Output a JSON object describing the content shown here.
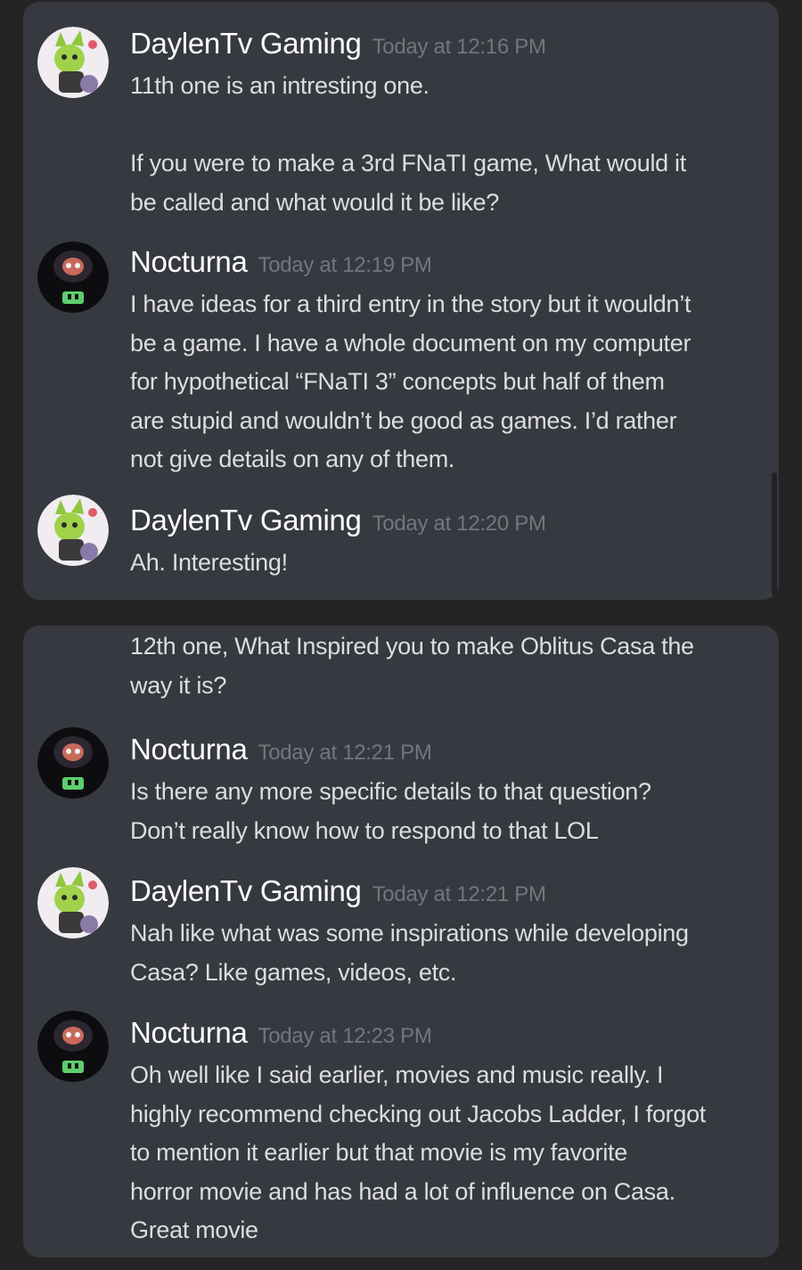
{
  "colors": {
    "page_background": "#262324",
    "panel_background": "#36393f",
    "author_name": "#ffffff",
    "timestamp": "#72767d",
    "message_text": "#dcddde",
    "daylen_avatar_bg": "#f1ecef",
    "nocturna_avatar_bg": "#0d0d0f"
  },
  "panel_1": {
    "messages": [
      {
        "author": "DaylenTv Gaming",
        "timestamp": "Today at 12:16 PM",
        "avatar": "daylen-avatar",
        "lines": [
          "11th one is an intresting one.",
          "",
          "If you were to make a 3rd FNaTI game, What would it",
          "be called and what would it be like?"
        ]
      },
      {
        "author": "Nocturna",
        "timestamp": "Today at 12:19 PM",
        "avatar": "nocturna-avatar",
        "lines": [
          "I have ideas for a third entry in the story but it wouldn’t",
          "be a game. I have a whole document on my computer",
          "for hypothetical “FNaTI 3” concepts but half of them",
          "are stupid and wouldn’t be good as games. I’d rather",
          "not give details on any of them."
        ]
      },
      {
        "author": "DaylenTv Gaming",
        "timestamp": "Today at 12:20 PM",
        "avatar": "daylen-avatar",
        "lines": [
          "Ah. Interesting!"
        ]
      }
    ]
  },
  "panel_2": {
    "continuation": {
      "lines": [
        "12th one, What Inspired you to make Oblitus Casa the",
        "way it is?"
      ]
    },
    "messages": [
      {
        "author": "Nocturna",
        "timestamp": "Today at 12:21 PM",
        "avatar": "nocturna-avatar",
        "lines": [
          "Is there any more specific details to that question?",
          "Don’t really know how to respond to that LOL"
        ]
      },
      {
        "author": "DaylenTv Gaming",
        "timestamp": "Today at 12:21 PM",
        "avatar": "daylen-avatar",
        "lines": [
          "Nah like what was some inspirations while developing",
          "Casa? Like games, videos, etc."
        ]
      },
      {
        "author": "Nocturna",
        "timestamp": "Today at 12:23 PM",
        "avatar": "nocturna-avatar",
        "lines": [
          "Oh well like I said earlier, movies and music really. I",
          "highly recommend checking out Jacobs Ladder, I forgot",
          "to mention it earlier but that movie is my favorite",
          "horror movie and has had a lot of influence on Casa.",
          "Great movie"
        ]
      }
    ]
  }
}
